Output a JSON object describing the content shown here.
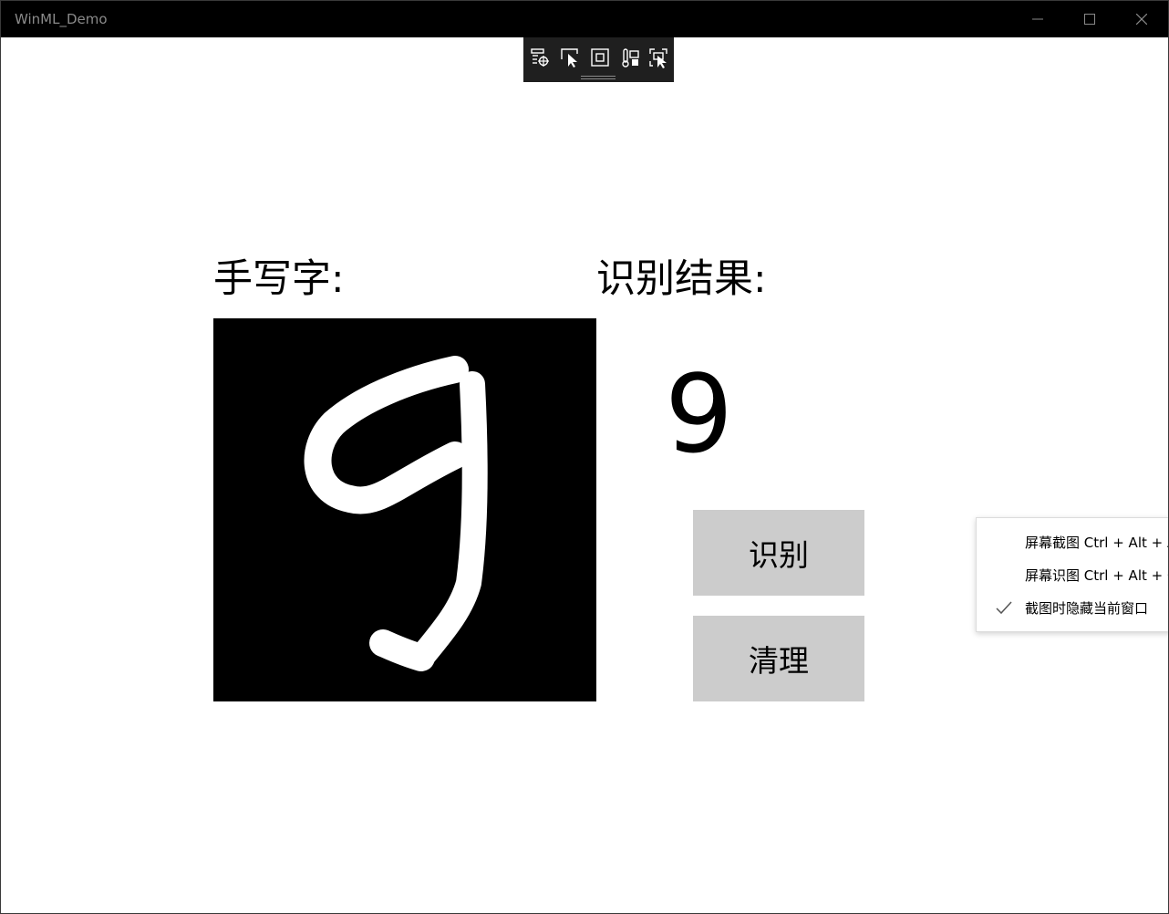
{
  "window": {
    "title": "WinML_Demo",
    "controls": {
      "minimize_icon": "minimize-icon",
      "maximize_icon": "maximize-icon",
      "close_icon": "close-icon"
    }
  },
  "debug_toolbar": {
    "icons": [
      "live-visual-tree-icon",
      "select-element-icon",
      "display-layout-adorners-icon",
      "track-focus-icon",
      "hot-reload-icon"
    ]
  },
  "main": {
    "handwriting_label": "手写字:",
    "result_label": "识别结果:",
    "result_value": "9",
    "recognize_button": "识别",
    "clear_button": "清理"
  },
  "context_menu": {
    "items": [
      {
        "label": "屏幕截图 Ctrl + Alt + A",
        "checked": false
      },
      {
        "label": "屏幕识图 Ctrl + Alt + O",
        "checked": false
      },
      {
        "label": "截图时隐藏当前窗口",
        "checked": true
      }
    ]
  },
  "colors": {
    "titlebar": "#000000",
    "canvas": "#000000",
    "ink": "#ffffff",
    "button": "#cccccc",
    "toolbar": "#1f1f1f"
  }
}
